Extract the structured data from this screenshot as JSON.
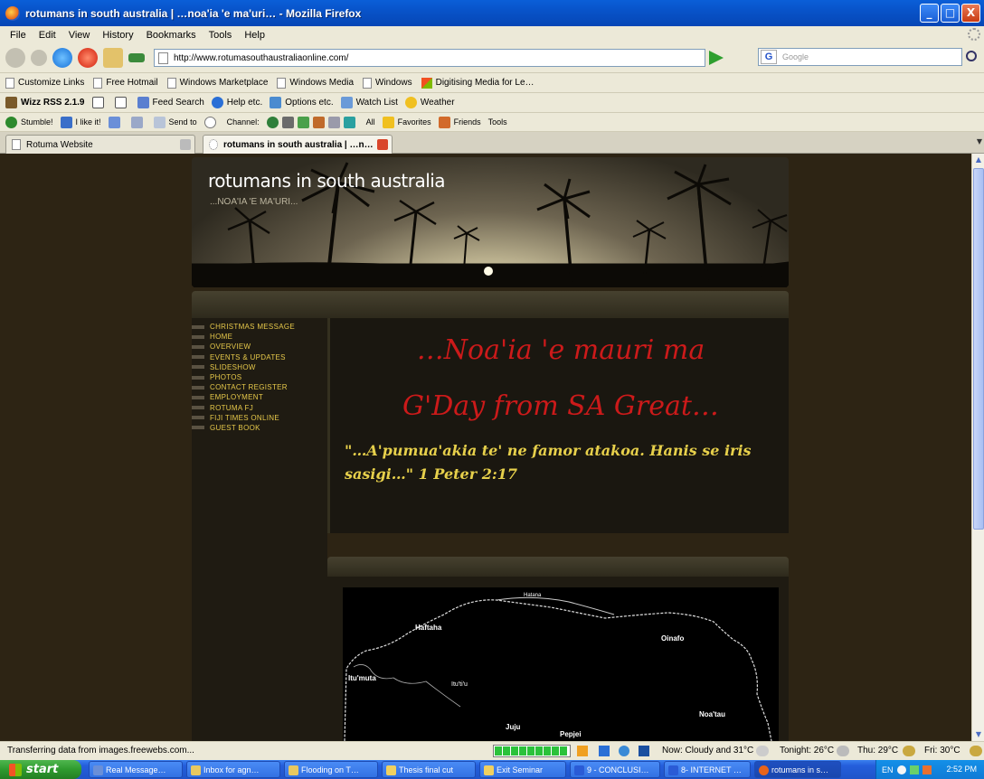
{
  "window": {
    "title": "rotumans in south australia | …noa'ia 'e ma'uri… - Mozilla Firefox",
    "buttons": [
      "_",
      "□",
      "X"
    ]
  },
  "menu": [
    "File",
    "Edit",
    "View",
    "History",
    "Bookmarks",
    "Tools",
    "Help"
  ],
  "navbar": {
    "url": "http://www.rotumasouthaustraliaonline.com/",
    "search_placeholder": "Google",
    "search_engine_label": "G"
  },
  "links_bar": [
    "Customize Links",
    "Free Hotmail",
    "Windows Marketplace",
    "Windows Media",
    "Windows",
    "Digitising Media for Le…"
  ],
  "wizz_bar": {
    "app": "Wizz RSS 2.1.9",
    "items": [
      "Feed Search",
      "Help etc.",
      "Options etc.",
      "Watch List",
      "Weather"
    ]
  },
  "stumble_bar": {
    "items": [
      "Stumble!",
      "I like it!",
      "Send to",
      "Channel:",
      "All",
      "Favorites",
      "Friends",
      "Tools"
    ]
  },
  "tabs": [
    {
      "label": "Rotuma Website",
      "active": false
    },
    {
      "label": "rotumans in south australia | …n…",
      "active": true
    }
  ],
  "site": {
    "title": "rotumans in south australia",
    "subtitle": "...NOA'IA 'E MA'URI...",
    "nav": [
      "CHRISTMAS MESSAGE",
      "HOME",
      "OVERVIEW",
      "EVENTS & UPDATES",
      "SLIDESHOW",
      "PHOTOS",
      "CONTACT REGISTER",
      "EMPLOYMENT",
      "ROTUMA FJ",
      "FIJI TIMES ONLINE",
      "GUEST BOOK"
    ],
    "headline_1": "…Noa'ia 'e mauri  ma",
    "headline_2": "G'Day from SA Great…",
    "verse": "\"…A'pumua'akia te' ne famor atakoa. Hanis se iris sasigi…\" 1 Peter 2:17",
    "map_labels": [
      "Hatana",
      "Haftaha",
      "Oinafo",
      "Itu'muta",
      "Noa'tau",
      "Juju",
      "Pepjei",
      "Itu'ti'u"
    ]
  },
  "status": {
    "message": "Transferring data from images.freewebs.com...",
    "weather_now": "Now: Cloudy and 31°C",
    "tonight": "Tonight: 26°C",
    "thu": "Thu: 29°C",
    "fri": "Fri: 30°C"
  },
  "taskbar": {
    "start": "start",
    "tasks": [
      "Real Message…",
      "Inbox for agn…",
      "Flooding on T…",
      "Thesis final cut",
      "Exit Seminar",
      "9 - CONCLUSI…",
      "8- INTERNET …",
      "rotumans in s…"
    ],
    "tray_lang": "EN",
    "clock": "2:52 PM"
  },
  "colors": {
    "page_bg": "#2d2414",
    "headline": "#cc1a1a",
    "verse": "#e7d04b",
    "nav_text": "#e6c84a"
  }
}
